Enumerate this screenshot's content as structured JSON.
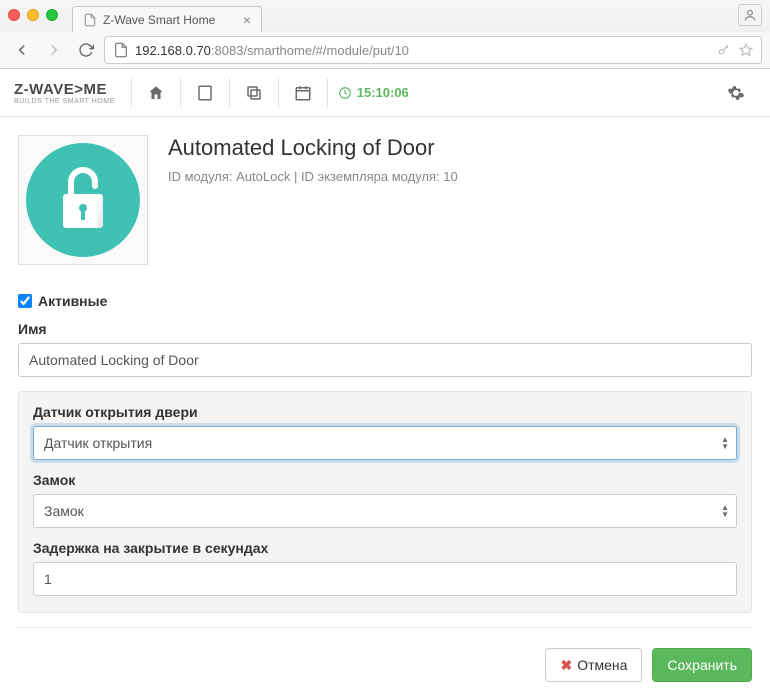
{
  "browser": {
    "tab_title": "Z-Wave Smart Home",
    "url_host": "192.168.0.70",
    "url_port_path": ":8083/smarthome/#/module/put/10"
  },
  "toolbar": {
    "logo_main": "Z-WAVE>ME",
    "logo_sub": "BUILDS THE SMART HOME",
    "time": "15:10:06"
  },
  "module": {
    "title": "Automated Locking of Door",
    "meta": "ID модуля: AutoLock | ID экземпляра модуля: 10"
  },
  "form": {
    "active_label": "Активные",
    "active_checked": true,
    "name_label": "Имя",
    "name_value": "Automated Locking of Door",
    "sensor_label": "Датчик открытия двери",
    "sensor_value": "Датчик открытия",
    "lock_label": "Замок",
    "lock_value": "Замок",
    "delay_label": "Задержка на закрытие в секундах",
    "delay_value": "1"
  },
  "footer": {
    "cancel": "Отмена",
    "save": "Сохранить"
  }
}
